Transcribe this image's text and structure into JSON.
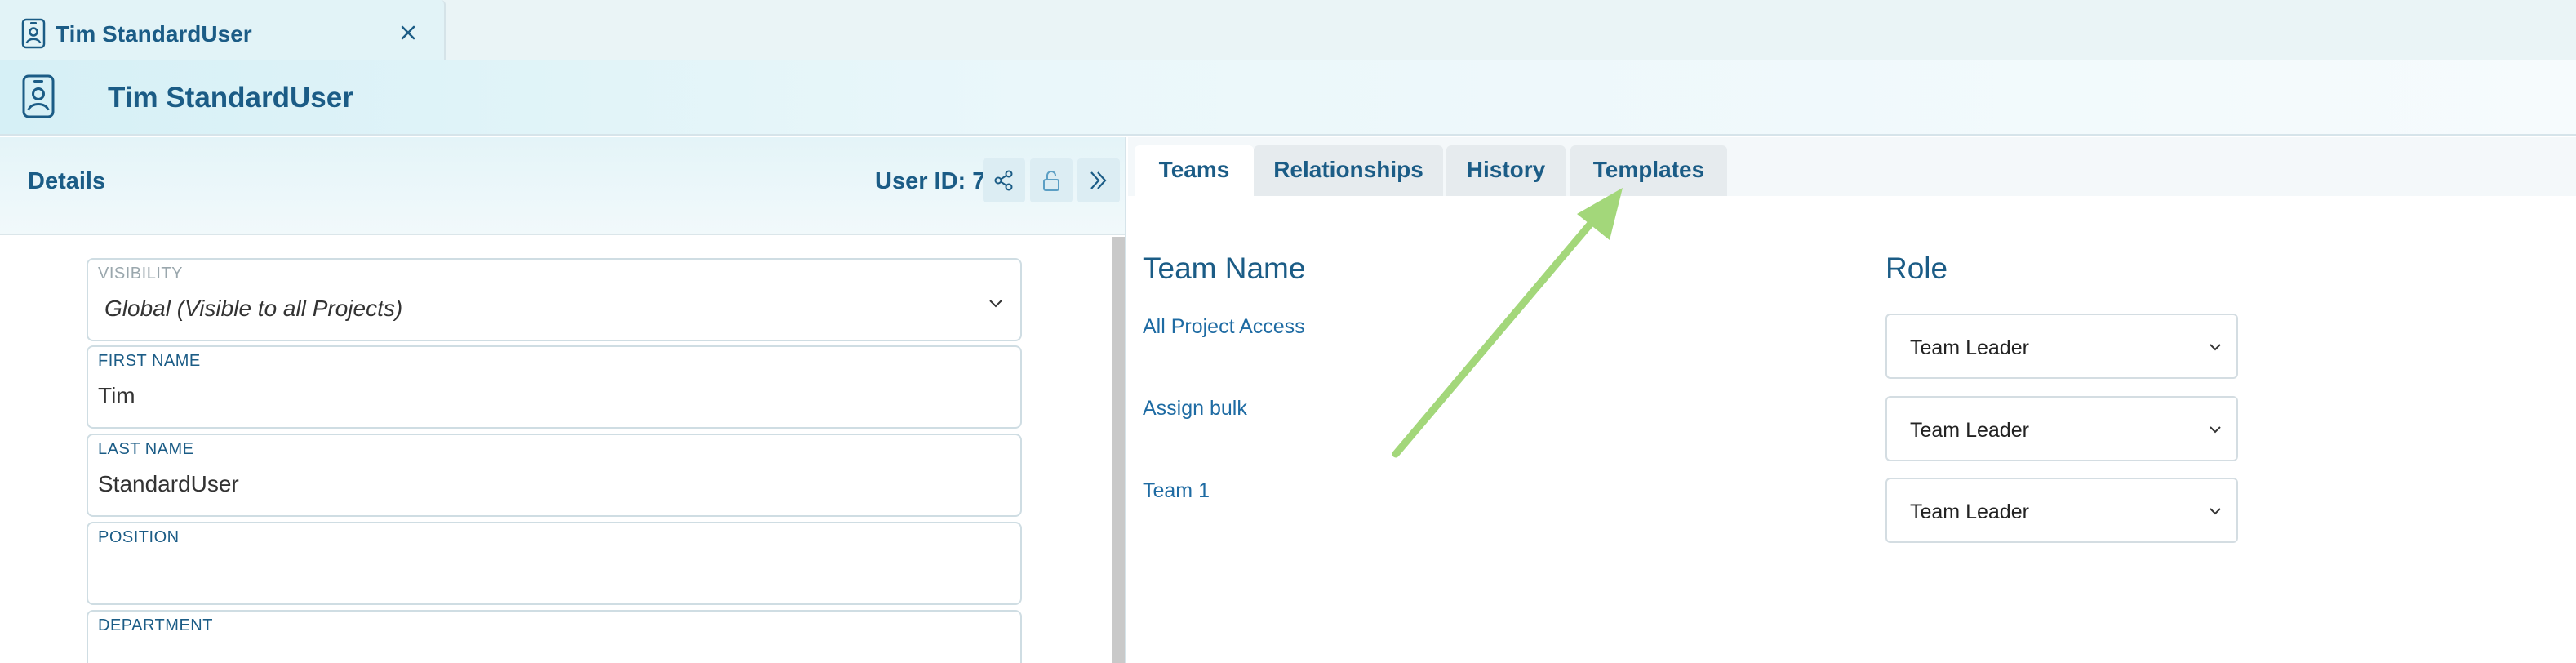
{
  "doc_tab": {
    "title": "Tim StandardUser",
    "icon": "contact-card-icon",
    "close_icon": "close-icon"
  },
  "header": {
    "title": "Tim StandardUser",
    "icon": "contact-card-icon"
  },
  "details": {
    "title": "Details",
    "user_id": "User ID: 7",
    "actions": [
      "share-icon",
      "unlock-icon",
      "expand-icon"
    ]
  },
  "form": {
    "visibility": {
      "label": "VISIBILITY",
      "value": "Global (Visible to all Projects)"
    },
    "first_name": {
      "label": "FIRST NAME",
      "value": "Tim"
    },
    "last_name": {
      "label": "LAST NAME",
      "value": "StandardUser"
    },
    "position": {
      "label": "POSITION",
      "value": ""
    },
    "department": {
      "label": "DEPARTMENT",
      "value": ""
    }
  },
  "tabs": [
    {
      "label": "Teams",
      "active": true
    },
    {
      "label": "Relationships",
      "active": false
    },
    {
      "label": "History",
      "active": false
    },
    {
      "label": "Templates",
      "active": false
    }
  ],
  "teams": {
    "col_team": "Team Name",
    "col_role": "Role",
    "rows": [
      {
        "team": "All Project Access",
        "role": "Team Leader"
      },
      {
        "team": "Assign bulk",
        "role": "Team Leader"
      },
      {
        "team": "Team 1",
        "role": "Team Leader"
      }
    ]
  },
  "colors": {
    "primary": "#1b5c86",
    "link": "#1e6ba3",
    "annotation_arrow": "#a3d77a"
  }
}
